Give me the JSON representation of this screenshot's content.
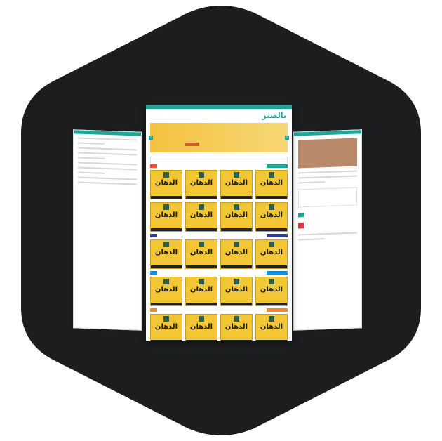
{
  "colors": {
    "background": "#ffffff",
    "hexagon": "#1b1d1f",
    "teal": "#1ea59a",
    "yellow_card": "#f2c634",
    "banner_orange": "#f0a92a"
  },
  "main_page": {
    "logo": {
      "text_main": "بالصنز",
      "accent": "صنز"
    },
    "cards": {
      "brand_text": "الدهان"
    }
  }
}
